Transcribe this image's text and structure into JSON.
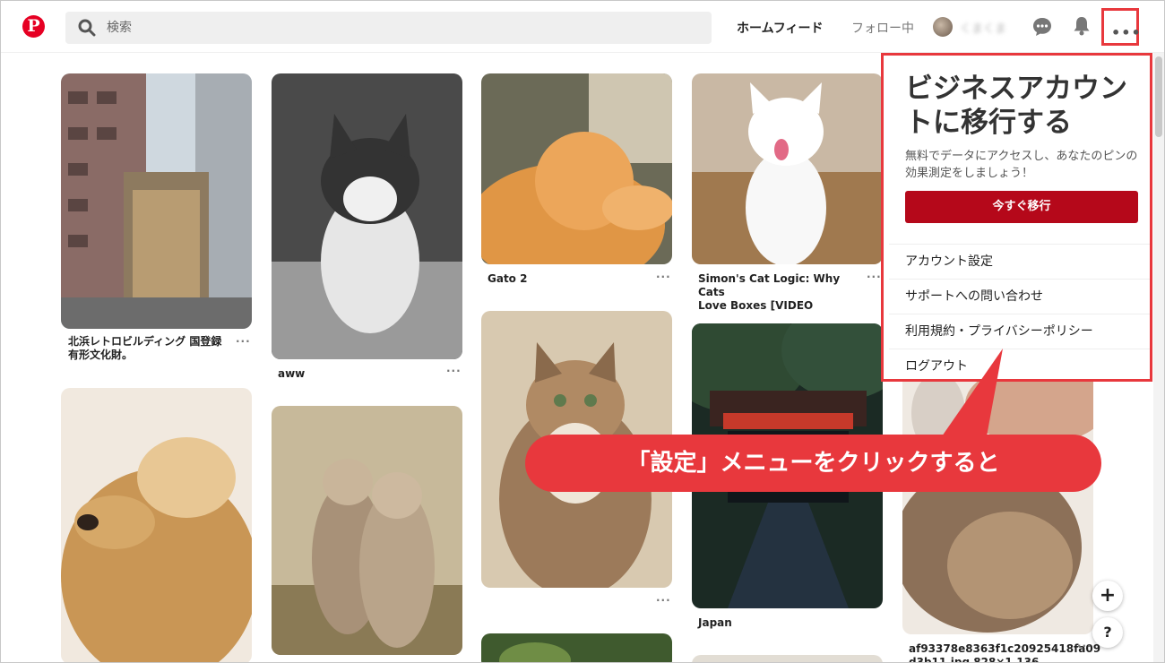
{
  "header": {
    "logo_letter": "P",
    "search_placeholder": "検索",
    "nav_home": "ホームフィード",
    "nav_following": "フォロー中",
    "username": "くまくま",
    "more_label": "•••"
  },
  "pins": [
    {
      "title": "北浜レトロビルディング 国登録\n有形文化財。"
    },
    {
      "title": "aww"
    },
    {
      "title": "Gato 2"
    },
    {
      "title": "Simon's Cat Logic: Why Cats\nLove Boxes [VIDEO"
    },
    {
      "title": "Japan"
    },
    {
      "title": "af93378e8363f1c20925418fa09\nd3b11.jpg 828×1,136"
    }
  ],
  "pin_more_label": "···",
  "dropdown": {
    "title": "ビジネスアカウントに移行する",
    "subtitle": "無料でデータにアクセスし、あなたのピンの効果測定をしましょう！",
    "cta": "今すぐ移行",
    "items": [
      "アカウント設定",
      "サポートへの問い合わせ",
      "利用規約・プライバシーポリシー",
      "ログアウト"
    ]
  },
  "callout": "「設定」メニューをクリックすると",
  "fab_add": "+",
  "fab_help": "?",
  "colors": {
    "brand": "#e60023",
    "highlight": "#e8383d",
    "cta": "#b5081a"
  }
}
